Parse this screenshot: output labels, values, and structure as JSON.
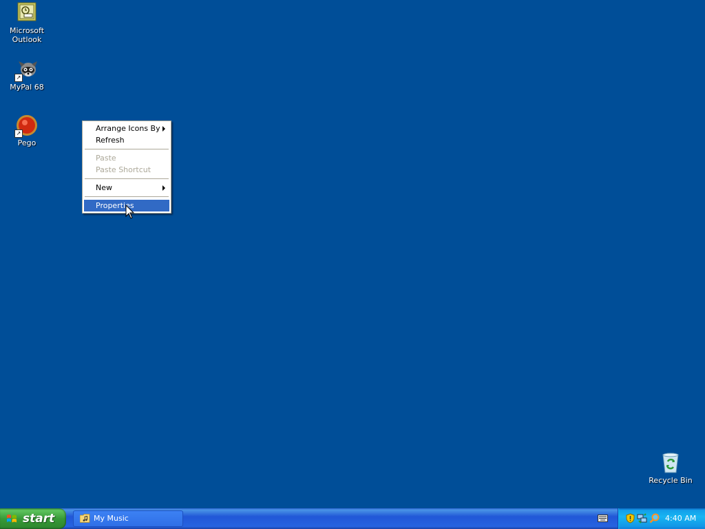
{
  "desktop": {
    "background_color": "#004e98",
    "icons": [
      {
        "label": "Microsoft Outlook",
        "icon": "outlook-icon"
      },
      {
        "label": "MyPal 68",
        "icon": "raccoon-icon"
      },
      {
        "label": "Pego",
        "icon": "pego-icon"
      },
      {
        "label": "Recycle Bin",
        "icon": "recycle-bin-icon"
      }
    ]
  },
  "context_menu": {
    "items": [
      {
        "label": "Arrange Icons By",
        "submenu": true,
        "enabled": true
      },
      {
        "label": "Refresh",
        "enabled": true
      },
      {
        "label": "Paste",
        "enabled": false
      },
      {
        "label": "Paste Shortcut",
        "enabled": false
      },
      {
        "label": "New",
        "submenu": true,
        "enabled": true
      },
      {
        "label": "Properties",
        "enabled": true,
        "highlighted": true
      }
    ],
    "highlight_color": "#316ac5"
  },
  "taskbar": {
    "start_label": "start",
    "tasks": [
      {
        "label": "My Music",
        "icon": "folder-music-icon"
      }
    ],
    "tray_icons": [
      "security-shield-icon",
      "network-icon",
      "search-magnifier-icon"
    ],
    "clock": "4:40 AM"
  }
}
